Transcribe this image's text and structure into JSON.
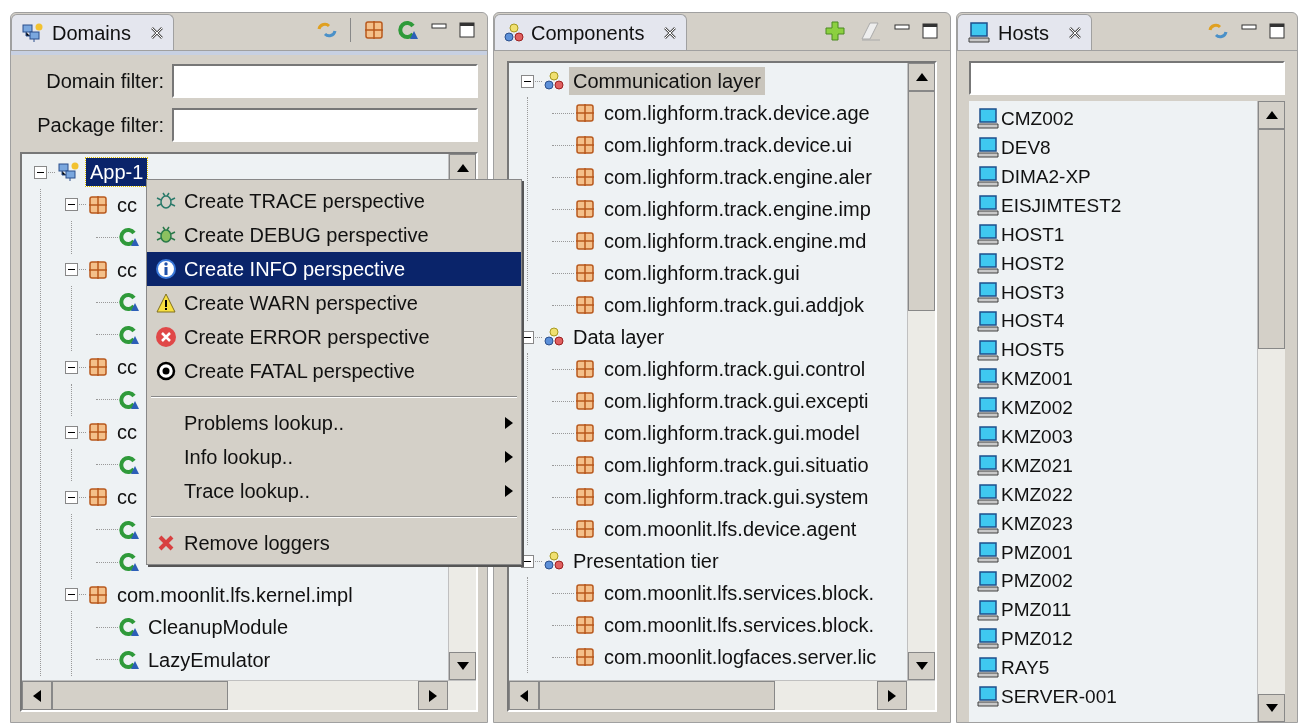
{
  "domains_view": {
    "title": "Domains",
    "filters": [
      {
        "label": "Domain filter:"
      },
      {
        "label": "Package filter:"
      }
    ],
    "tree": [
      {
        "label": "App-1",
        "kind": "app",
        "expanded": true,
        "selected": true,
        "children": [
          {
            "label": "cc",
            "kind": "package",
            "expanded": true,
            "selected": false,
            "children": [
              {
                "kind": "component"
              }
            ]
          },
          {
            "label": "cc",
            "kind": "package",
            "expanded": true,
            "selected": false,
            "children": [
              {
                "kind": "component"
              },
              {
                "kind": "component"
              }
            ]
          },
          {
            "label": "cc",
            "kind": "package",
            "expanded": true,
            "selected": false,
            "children": [
              {
                "kind": "component"
              }
            ]
          },
          {
            "label": "cc",
            "kind": "package",
            "expanded": true,
            "selected": false,
            "children": [
              {
                "kind": "component"
              }
            ]
          },
          {
            "label": "cc",
            "kind": "package",
            "expanded": true,
            "selected": false,
            "children": [
              {
                "kind": "component"
              },
              {
                "kind": "component"
              }
            ]
          },
          {
            "label": "com.moonlit.lfs.kernel.impl",
            "kind": "package",
            "expanded": true,
            "selected": false,
            "children": [
              {
                "label": "CleanupModule",
                "kind": "component",
                "selected": false
              },
              {
                "label": "LazyEmulator",
                "kind": "component",
                "selected": false
              }
            ]
          }
        ]
      }
    ]
  },
  "context_menu": [
    {
      "kind": "action",
      "label": "Create TRACE perspective",
      "selected": false
    },
    {
      "kind": "action",
      "label": "Create DEBUG perspective",
      "selected": false
    },
    {
      "kind": "action",
      "label": "Create INFO perspective",
      "selected": true
    },
    {
      "kind": "action",
      "label": "Create WARN perspective",
      "selected": false
    },
    {
      "kind": "action",
      "label": "Create ERROR perspective",
      "selected": false
    },
    {
      "kind": "action",
      "label": "Create FATAL perspective",
      "selected": false
    },
    {
      "kind": "separator"
    },
    {
      "kind": "submenu",
      "label": "Problems lookup..",
      "selected": false
    },
    {
      "kind": "submenu",
      "label": "Info lookup..",
      "selected": false
    },
    {
      "kind": "submenu",
      "label": "Trace lookup..",
      "selected": false
    },
    {
      "kind": "separator"
    },
    {
      "kind": "action",
      "label": "Remove loggers",
      "selected": false
    }
  ],
  "components_view": {
    "title": "Components",
    "tree": [
      {
        "label": "Communication layer",
        "kind": "group",
        "expanded": true,
        "selected": true,
        "children": [
          {
            "label": "com.lighform.track.device.age",
            "kind": "package",
            "selected": false
          },
          {
            "label": "com.lighform.track.device.ui",
            "kind": "package",
            "selected": false
          },
          {
            "label": "com.lighform.track.engine.aler",
            "kind": "package",
            "selected": false
          },
          {
            "label": "com.lighform.track.engine.imp",
            "kind": "package",
            "selected": false
          },
          {
            "label": "com.lighform.track.engine.md",
            "kind": "package",
            "selected": false
          },
          {
            "label": "com.lighform.track.gui",
            "kind": "package",
            "selected": false
          },
          {
            "label": "com.lighform.track.gui.addjok",
            "kind": "package",
            "selected": false
          }
        ]
      },
      {
        "label": "Data layer",
        "kind": "group",
        "expanded": true,
        "selected": false,
        "children": [
          {
            "label": "com.lighform.track.gui.control",
            "kind": "package",
            "selected": false
          },
          {
            "label": "com.lighform.track.gui.excepti",
            "kind": "package",
            "selected": false
          },
          {
            "label": "com.lighform.track.gui.model",
            "kind": "package",
            "selected": false
          },
          {
            "label": "com.lighform.track.gui.situatio",
            "kind": "package",
            "selected": false
          },
          {
            "label": "com.lighform.track.gui.system",
            "kind": "package",
            "selected": false
          },
          {
            "label": "com.moonlit.lfs.device.agent",
            "kind": "package",
            "selected": false
          }
        ]
      },
      {
        "label": "Presentation tier",
        "kind": "group",
        "expanded": true,
        "selected": false,
        "children": [
          {
            "label": "com.moonlit.lfs.services.block.",
            "kind": "package",
            "selected": false
          },
          {
            "label": "com.moonlit.lfs.services.block.",
            "kind": "package",
            "selected": false
          },
          {
            "label": "com.moonlit.logfaces.server.lic",
            "kind": "package",
            "selected": false
          }
        ]
      }
    ]
  },
  "hosts_view": {
    "title": "Hosts",
    "hosts": [
      "CMZ002",
      "DEV8",
      "DIMA2-XP",
      "EISJIMTEST2",
      "HOST1",
      "HOST2",
      "HOST3",
      "HOST4",
      "HOST5",
      "KMZ001",
      "KMZ002",
      "KMZ003",
      "KMZ021",
      "KMZ022",
      "KMZ023",
      "PMZ001",
      "PMZ002",
      "PMZ011",
      "PMZ012",
      "RAY5",
      "SERVER-001"
    ]
  }
}
